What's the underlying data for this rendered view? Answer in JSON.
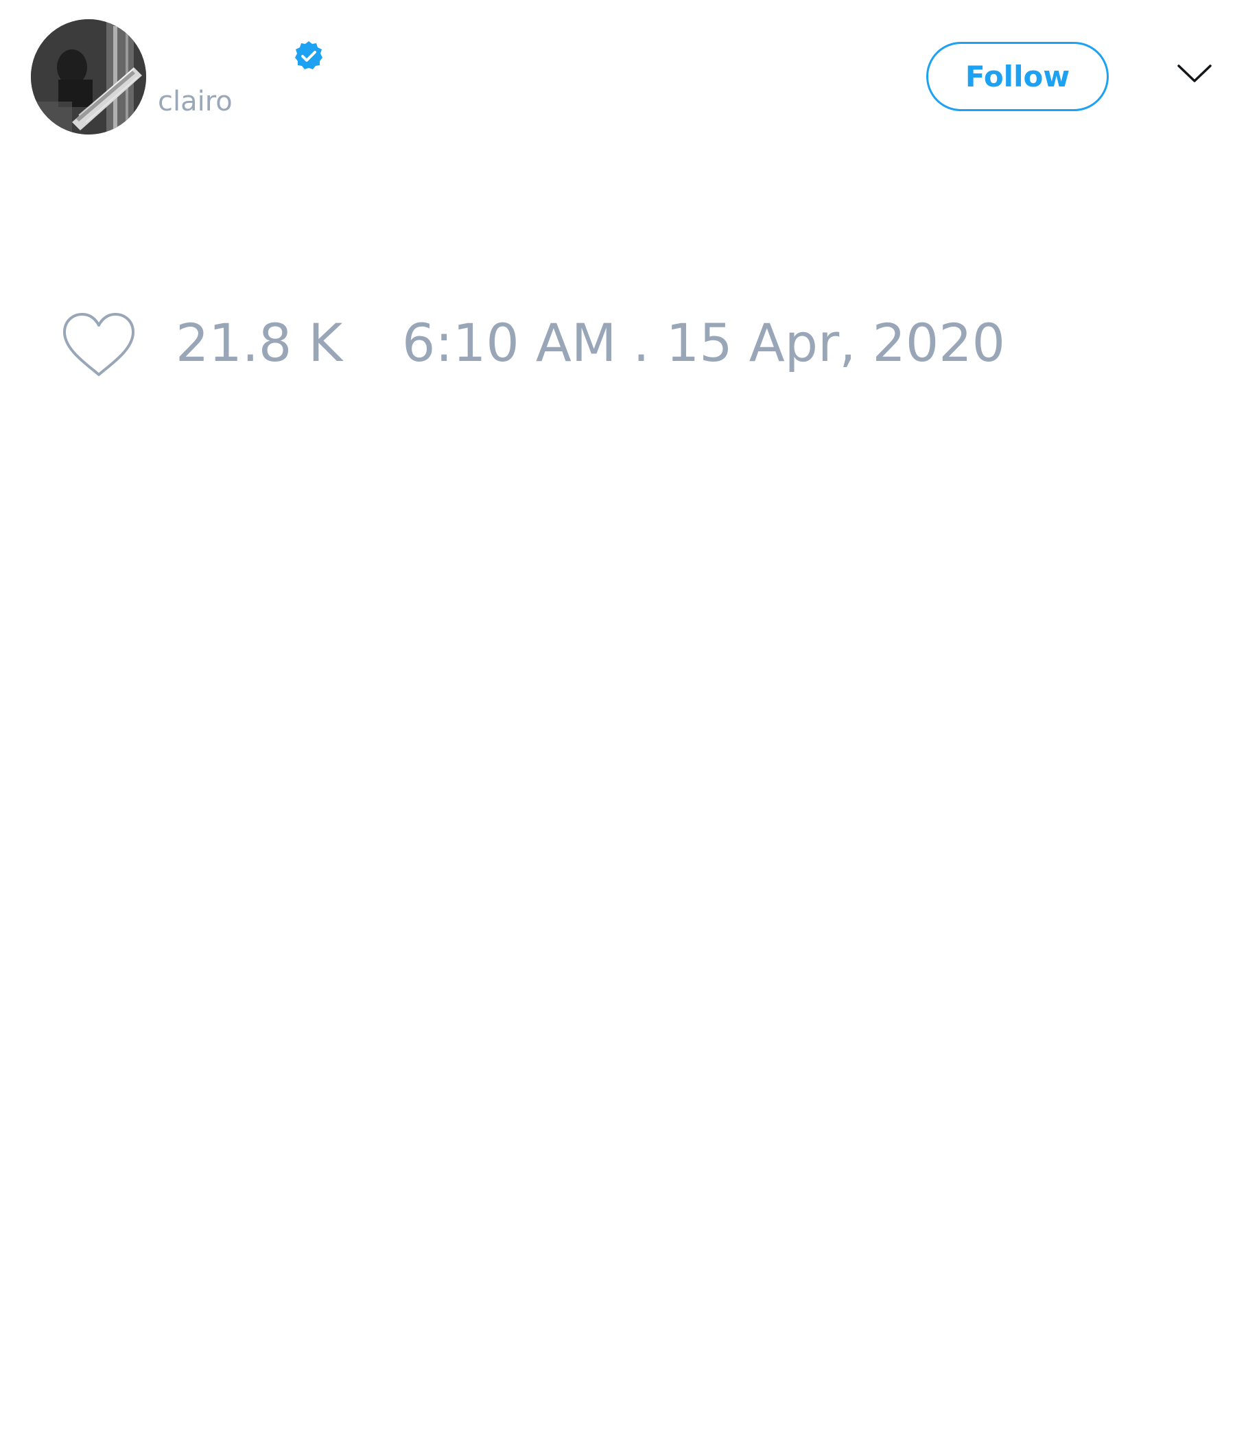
{
  "tweet": {
    "author": {
      "display_name": "",
      "handle": "clairo",
      "verified": true,
      "avatar_icon": "user-avatar-photo"
    },
    "follow_label": "Follow",
    "menu_icon": "chevron-down-icon",
    "likes": {
      "icon": "heart-icon",
      "count": "21.8 K"
    },
    "timestamp": "6:10 AM . 15 Apr, 2020"
  },
  "colors": {
    "accent": "#1da1f2",
    "muted_text": "#99a6b7",
    "background": "#ffffff"
  }
}
